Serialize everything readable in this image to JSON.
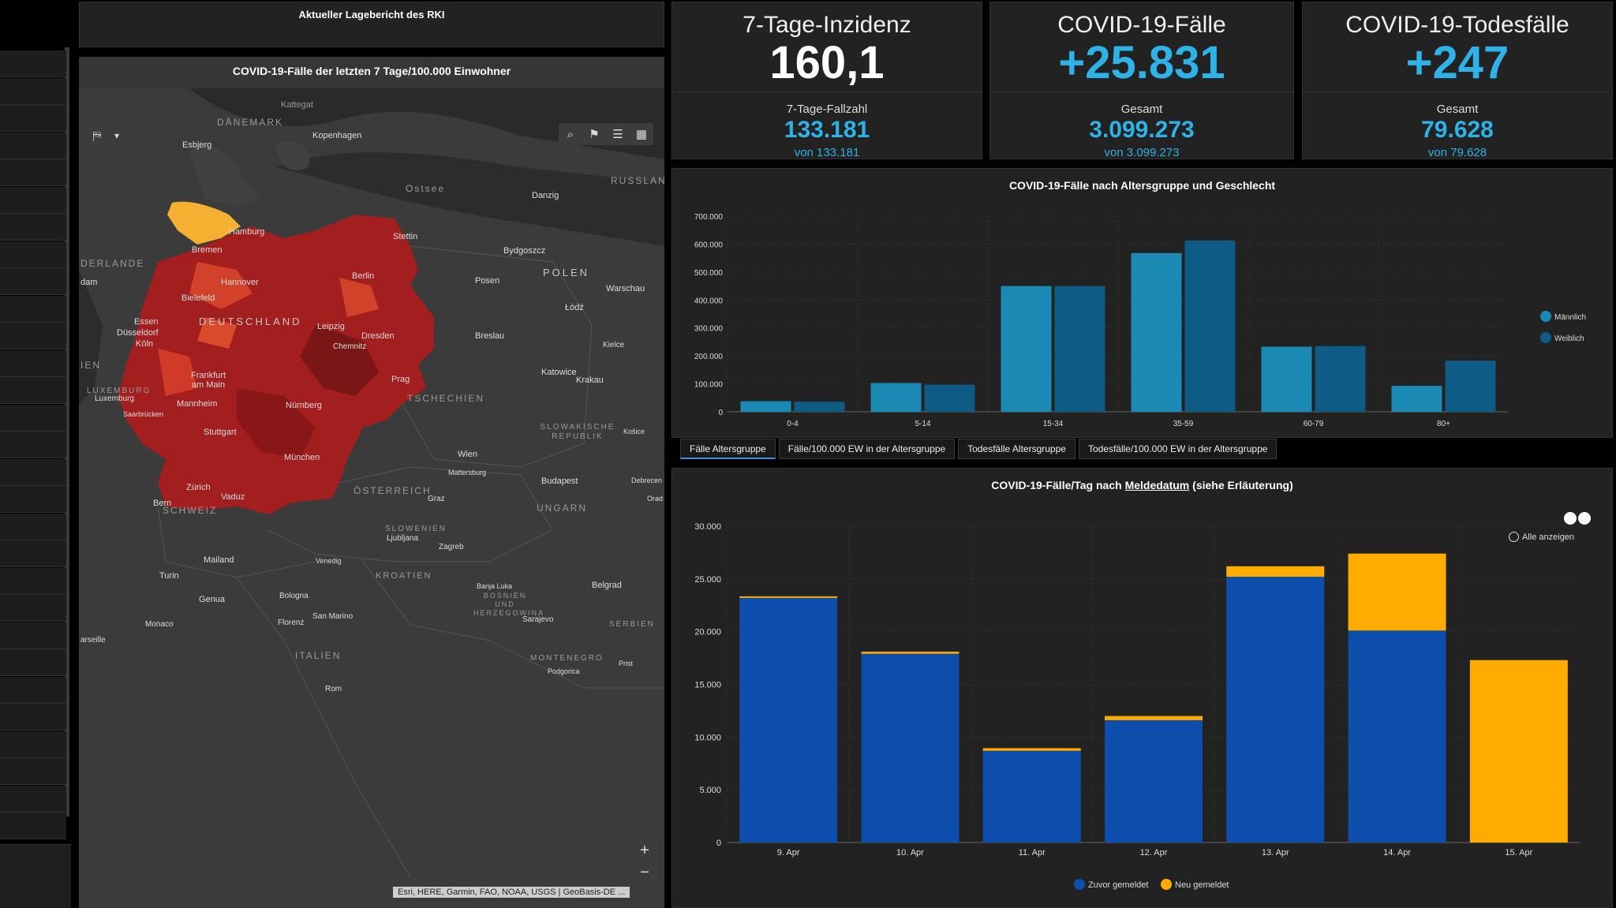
{
  "header": {
    "title": "Aktueller Lagebericht des RKI"
  },
  "map": {
    "title": "COVID-19-Fälle der letzten 7 Tage/100.000 Einwohner",
    "attribution": "Esri, HERE, Garmin, FAO, NOAA, USGS | GeoBasis-DE ...",
    "zoom_in": "+",
    "zoom_out": "−",
    "labels": {
      "kattegat": "Kattegat",
      "daenemark": "DÄNEMARK",
      "kopenhagen": "Kopenhagen",
      "esbjerg": "Esbjerg",
      "ostsee": "Ostsee",
      "russland": "RUSSLAND",
      "danzig": "Danzig",
      "hamburg": "Hamburg",
      "stettin": "Stettin",
      "bremen": "Bremen",
      "bydgoszcz": "Bydgoszcz",
      "niederlande": "DERLANDE",
      "dam": "dam",
      "hannover": "Hannover",
      "berlin": "Berlin",
      "posen": "Posen",
      "polen": "POLEN",
      "warschau": "Warschau",
      "bielefeld": "Bielefeld",
      "lodz": "Łódź",
      "essen": "Essen",
      "deutschland": "DEUTSCHLAND",
      "duesseldorf": "Düsseldorf",
      "leipzig": "Leipzig",
      "koeln": "Köln",
      "dresden": "Dresden",
      "breslau": "Breslau",
      "chemnitz": "Chemnitz",
      "kielce": "Kielce",
      "ien": "IEN",
      "frankfurt": "Frankfurt am Main",
      "prag": "Prag",
      "katowice": "Katowice",
      "krakau": "Krakau",
      "luxemburg_c": "LUXEMBURG",
      "luxemburg": "Luxemburg",
      "mannheim": "Mannheim",
      "nuernberg": "Nürnberg",
      "tschechien": "TSCHECHIEN",
      "saarbruecken": "Saarbrücken",
      "slowakei": "SLOWAKISCHE REPUBLIK",
      "kosice": "Košice",
      "stuttgart": "Stuttgart",
      "muenchen": "München",
      "wien": "Wien",
      "mattersburg": "Mattersburg",
      "zuerich": "Zürich",
      "budapest": "Budapest",
      "debrecen": "Debrecen",
      "vaduz": "Vaduz",
      "oesterreich": "ÖSTERREICH",
      "graz": "Graz",
      "bern": "Bern",
      "schweiz": "SCHWEIZ",
      "ungarn": "UNGARN",
      "oradea": "Orad",
      "slowenien": "SLOWENIEN",
      "ljubljana": "Ljubljana",
      "zagreb": "Zagreb",
      "mailand": "Mailand",
      "venedig": "Venedig",
      "kroatien": "KROATIEN",
      "turin": "Turin",
      "banjaluka": "Banja Luka",
      "bosnien": "BOSNIEN UND HERZEGOWINA",
      "belgrad": "Belgrad",
      "genua": "Genua",
      "bologna": "Bologna",
      "sanmarino": "San Marino",
      "sarajevo": "Sarajevo",
      "monaco": "Monaco",
      "florenz": "Florenz",
      "serbien": "SERBIEN",
      "marseille": "arseille",
      "italien": "ITALIEN",
      "montenegro": "MONTENEGRO",
      "prist": "Prist",
      "podgorica": "Podgorica",
      "rom": "Rom"
    }
  },
  "kpis": [
    {
      "head": "7-Tage-Inzidenz",
      "big": "160,1",
      "sub": "7-Tage-Fallzahl",
      "mid": "133.181",
      "von": "von 133.181",
      "color": "#ffffff"
    },
    {
      "head": "COVID-19-Fälle",
      "big": "+25.831",
      "sub": "Gesamt",
      "mid": "3.099.273",
      "von": "von 3.099.273",
      "color": "#2eb3e8"
    },
    {
      "head": "COVID-19-Todesfälle",
      "big": "+247",
      "sub": "Gesamt",
      "mid": "79.628",
      "von": "von 79.628",
      "color": "#2eb3e8"
    }
  ],
  "age_chart": {
    "tabs": [
      "Fälle Altersgruppe",
      "Fälle/100.000 EW in der Altersgruppe",
      "Todesfälle Altersgruppe",
      "Todesfälle/100.000 EW in der Altersgruppe"
    ]
  },
  "daily_chart": {
    "title_prefix": "COVID-19-Fälle/Tag nach",
    "title_link": "Meldedatum",
    "title_suffix": "(siehe Erläuterung)",
    "show_all": "Alle anzeigen"
  },
  "chart_data": [
    {
      "type": "bar",
      "title": "COVID-19-Fälle nach Altersgruppe und Geschlecht",
      "categories": [
        "0-4",
        "5-14",
        "15-34",
        "35-59",
        "60-79",
        "80+"
      ],
      "series": [
        {
          "name": "Männlich",
          "color": "#1a8ab5",
          "values": [
            38000,
            103000,
            450000,
            568000,
            233000,
            93000
          ]
        },
        {
          "name": "Weiblich",
          "color": "#0e5b86",
          "values": [
            36000,
            97000,
            450000,
            613000,
            235000,
            183000
          ]
        }
      ],
      "ylim": [
        0,
        700000
      ],
      "yticks": [
        "0",
        "100.000",
        "200.000",
        "300.000",
        "400.000",
        "500.000",
        "600.000",
        "700.000"
      ],
      "legend": "right",
      "grid": true
    },
    {
      "type": "bar",
      "stacked": true,
      "title": "COVID-19-Fälle/Tag nach Meldedatum (siehe Erläuterung)",
      "categories": [
        "9. Apr",
        "10. Apr",
        "11. Apr",
        "12. Apr",
        "13. Apr",
        "14. Apr",
        "15. Apr"
      ],
      "series": [
        {
          "name": "Zuvor gemeldet",
          "color": "#0d4dac",
          "values": [
            23200,
            17900,
            8700,
            11600,
            25200,
            20100,
            0
          ]
        },
        {
          "name": "Neu gemeldet",
          "color": "#ffab00",
          "values": [
            150,
            200,
            250,
            400,
            1000,
            7300,
            17300
          ]
        }
      ],
      "ylim": [
        0,
        30000
      ],
      "yticks": [
        "0",
        "5.000",
        "10.000",
        "15.000",
        "20.000",
        "25.000",
        "30.000"
      ],
      "legend": "bottom",
      "grid": true
    }
  ]
}
